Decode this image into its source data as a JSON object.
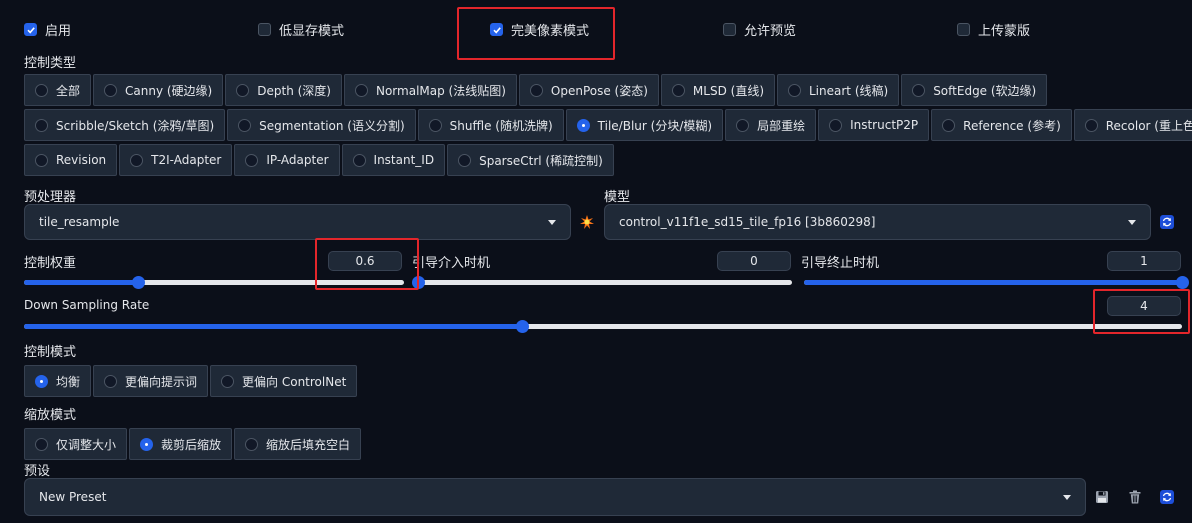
{
  "top_checkboxes": [
    {
      "label": "启用",
      "checked": true
    },
    {
      "label": "低显存模式",
      "checked": false
    },
    {
      "label": "完美像素模式",
      "checked": true
    },
    {
      "label": "允许预览",
      "checked": false
    },
    {
      "label": "上传蒙版",
      "checked": false
    }
  ],
  "control_type": {
    "label": "控制类型",
    "rows": [
      [
        "全部",
        "Canny (硬边缘)",
        "Depth (深度)",
        "NormalMap (法线贴图)",
        "OpenPose (姿态)",
        "MLSD (直线)",
        "Lineart (线稿)",
        "SoftEdge (软边缘)"
      ],
      [
        "Scribble/Sketch (涂鸦/草图)",
        "Segmentation (语义分割)",
        "Shuffle (随机洗牌)",
        "Tile/Blur (分块/模糊)",
        "局部重绘",
        "InstructP2P",
        "Reference (参考)",
        "Recolor (重上色)"
      ],
      [
        "Revision",
        "T2I-Adapter",
        "IP-Adapter",
        "Instant_ID",
        "SparseCtrl (稀疏控制)"
      ]
    ],
    "selected": "Tile/Blur (分块/模糊)"
  },
  "preprocessor": {
    "label": "预处理器",
    "value": "tile_resample"
  },
  "model": {
    "label": "模型",
    "value": "control_v11f1e_sd15_tile_fp16 [3b860298]"
  },
  "control_weight": {
    "label": "控制权重",
    "value": "0.6",
    "fraction": 0.3
  },
  "guidance_start": {
    "label": "引导介入时机",
    "value": "0",
    "fraction": 0.0
  },
  "guidance_end": {
    "label": "引导终止时机",
    "value": "1",
    "fraction": 1.0
  },
  "down_sampling": {
    "label": "Down Sampling Rate",
    "value": "4",
    "fraction": 0.43
  },
  "control_mode": {
    "label": "控制模式",
    "options": [
      "均衡",
      "更偏向提示词",
      "更偏向 ControlNet"
    ],
    "selected": "均衡"
  },
  "resize_mode": {
    "label": "缩放模式",
    "options": [
      "仅调整大小",
      "裁剪后缩放",
      "缩放后填充空白"
    ],
    "selected": "裁剪后缩放"
  },
  "preset": {
    "label": "预设",
    "value": "New Preset"
  },
  "colors": {
    "accent": "#2563eb",
    "highlight": "#e3262b",
    "background": "#0b0f19"
  }
}
